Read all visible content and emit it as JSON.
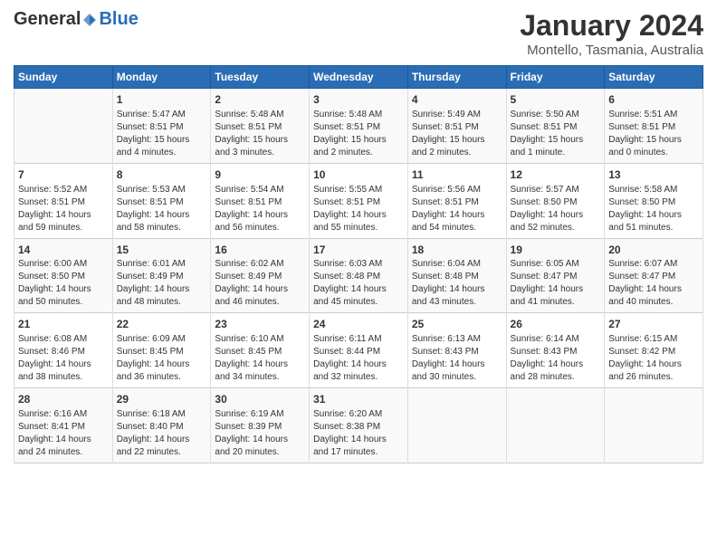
{
  "header": {
    "logo_general": "General",
    "logo_blue": "Blue",
    "title": "January 2024",
    "subtitle": "Montello, Tasmania, Australia"
  },
  "columns": [
    "Sunday",
    "Monday",
    "Tuesday",
    "Wednesday",
    "Thursday",
    "Friday",
    "Saturday"
  ],
  "weeks": [
    [
      {
        "day": "",
        "info": ""
      },
      {
        "day": "1",
        "info": "Sunrise: 5:47 AM\nSunset: 8:51 PM\nDaylight: 15 hours\nand 4 minutes."
      },
      {
        "day": "2",
        "info": "Sunrise: 5:48 AM\nSunset: 8:51 PM\nDaylight: 15 hours\nand 3 minutes."
      },
      {
        "day": "3",
        "info": "Sunrise: 5:48 AM\nSunset: 8:51 PM\nDaylight: 15 hours\nand 2 minutes."
      },
      {
        "day": "4",
        "info": "Sunrise: 5:49 AM\nSunset: 8:51 PM\nDaylight: 15 hours\nand 2 minutes."
      },
      {
        "day": "5",
        "info": "Sunrise: 5:50 AM\nSunset: 8:51 PM\nDaylight: 15 hours\nand 1 minute."
      },
      {
        "day": "6",
        "info": "Sunrise: 5:51 AM\nSunset: 8:51 PM\nDaylight: 15 hours\nand 0 minutes."
      }
    ],
    [
      {
        "day": "7",
        "info": "Sunrise: 5:52 AM\nSunset: 8:51 PM\nDaylight: 14 hours\nand 59 minutes."
      },
      {
        "day": "8",
        "info": "Sunrise: 5:53 AM\nSunset: 8:51 PM\nDaylight: 14 hours\nand 58 minutes."
      },
      {
        "day": "9",
        "info": "Sunrise: 5:54 AM\nSunset: 8:51 PM\nDaylight: 14 hours\nand 56 minutes."
      },
      {
        "day": "10",
        "info": "Sunrise: 5:55 AM\nSunset: 8:51 PM\nDaylight: 14 hours\nand 55 minutes."
      },
      {
        "day": "11",
        "info": "Sunrise: 5:56 AM\nSunset: 8:51 PM\nDaylight: 14 hours\nand 54 minutes."
      },
      {
        "day": "12",
        "info": "Sunrise: 5:57 AM\nSunset: 8:50 PM\nDaylight: 14 hours\nand 52 minutes."
      },
      {
        "day": "13",
        "info": "Sunrise: 5:58 AM\nSunset: 8:50 PM\nDaylight: 14 hours\nand 51 minutes."
      }
    ],
    [
      {
        "day": "14",
        "info": "Sunrise: 6:00 AM\nSunset: 8:50 PM\nDaylight: 14 hours\nand 50 minutes."
      },
      {
        "day": "15",
        "info": "Sunrise: 6:01 AM\nSunset: 8:49 PM\nDaylight: 14 hours\nand 48 minutes."
      },
      {
        "day": "16",
        "info": "Sunrise: 6:02 AM\nSunset: 8:49 PM\nDaylight: 14 hours\nand 46 minutes."
      },
      {
        "day": "17",
        "info": "Sunrise: 6:03 AM\nSunset: 8:48 PM\nDaylight: 14 hours\nand 45 minutes."
      },
      {
        "day": "18",
        "info": "Sunrise: 6:04 AM\nSunset: 8:48 PM\nDaylight: 14 hours\nand 43 minutes."
      },
      {
        "day": "19",
        "info": "Sunrise: 6:05 AM\nSunset: 8:47 PM\nDaylight: 14 hours\nand 41 minutes."
      },
      {
        "day": "20",
        "info": "Sunrise: 6:07 AM\nSunset: 8:47 PM\nDaylight: 14 hours\nand 40 minutes."
      }
    ],
    [
      {
        "day": "21",
        "info": "Sunrise: 6:08 AM\nSunset: 8:46 PM\nDaylight: 14 hours\nand 38 minutes."
      },
      {
        "day": "22",
        "info": "Sunrise: 6:09 AM\nSunset: 8:45 PM\nDaylight: 14 hours\nand 36 minutes."
      },
      {
        "day": "23",
        "info": "Sunrise: 6:10 AM\nSunset: 8:45 PM\nDaylight: 14 hours\nand 34 minutes."
      },
      {
        "day": "24",
        "info": "Sunrise: 6:11 AM\nSunset: 8:44 PM\nDaylight: 14 hours\nand 32 minutes."
      },
      {
        "day": "25",
        "info": "Sunrise: 6:13 AM\nSunset: 8:43 PM\nDaylight: 14 hours\nand 30 minutes."
      },
      {
        "day": "26",
        "info": "Sunrise: 6:14 AM\nSunset: 8:43 PM\nDaylight: 14 hours\nand 28 minutes."
      },
      {
        "day": "27",
        "info": "Sunrise: 6:15 AM\nSunset: 8:42 PM\nDaylight: 14 hours\nand 26 minutes."
      }
    ],
    [
      {
        "day": "28",
        "info": "Sunrise: 6:16 AM\nSunset: 8:41 PM\nDaylight: 14 hours\nand 24 minutes."
      },
      {
        "day": "29",
        "info": "Sunrise: 6:18 AM\nSunset: 8:40 PM\nDaylight: 14 hours\nand 22 minutes."
      },
      {
        "day": "30",
        "info": "Sunrise: 6:19 AM\nSunset: 8:39 PM\nDaylight: 14 hours\nand 20 minutes."
      },
      {
        "day": "31",
        "info": "Sunrise: 6:20 AM\nSunset: 8:38 PM\nDaylight: 14 hours\nand 17 minutes."
      },
      {
        "day": "",
        "info": ""
      },
      {
        "day": "",
        "info": ""
      },
      {
        "day": "",
        "info": ""
      }
    ]
  ]
}
